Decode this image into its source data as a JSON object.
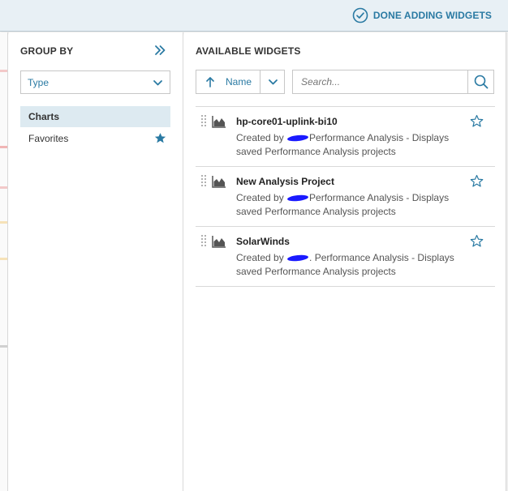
{
  "header": {
    "done_label": "DONE ADDING WIDGETS",
    "accent_color": "#2a7aa3"
  },
  "group_by": {
    "title": "GROUP BY",
    "select_value": "Type",
    "items": [
      {
        "label": "Charts",
        "selected": true
      },
      {
        "label": "Favorites",
        "selected": false,
        "icon": "star-filled-icon"
      }
    ]
  },
  "available": {
    "title": "AVAILABLE WIDGETS",
    "sort_label": "Name",
    "sort_direction": "ascending",
    "search_placeholder": "Search...",
    "widgets": [
      {
        "title": "hp-core01-uplink-bi10",
        "desc_prefix": "Created by",
        "desc_rest": "Performance Analysis - Displays saved Performance Analysis projects",
        "favorite": false
      },
      {
        "title": "New Analysis Project",
        "desc_prefix": "Created by",
        "desc_rest": "Performance Analysis - Displays saved Performance Analysis projects",
        "favorite": false
      },
      {
        "title": "SolarWinds",
        "desc_prefix": "Created by",
        "desc_rest": ". Performance Analysis - Displays saved Performance Analysis projects",
        "favorite": false
      }
    ]
  }
}
